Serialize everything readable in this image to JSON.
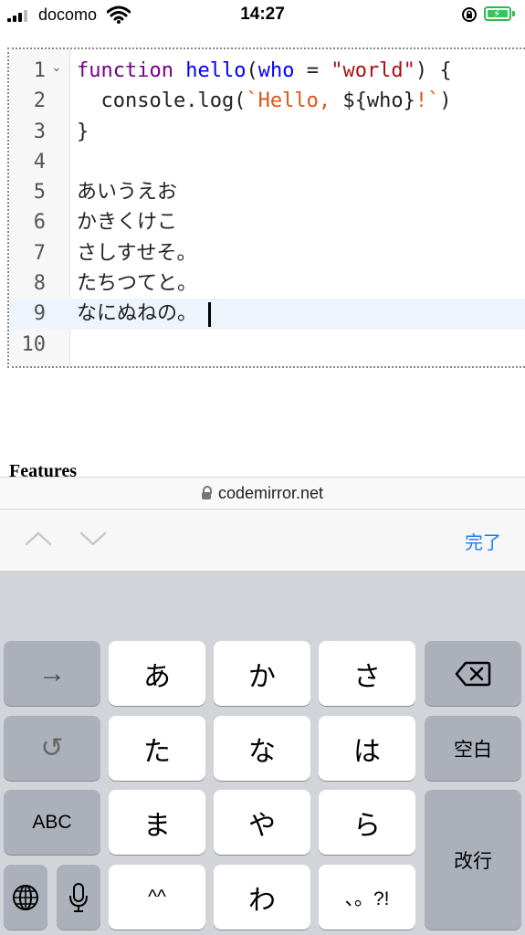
{
  "status_bar": {
    "carrier": "docomo",
    "time": "14:27"
  },
  "editor": {
    "active_line": 9,
    "fold_marker": "⌄",
    "lines": [
      {
        "number": "1",
        "text": "function hello(who = \"world\") {"
      },
      {
        "number": "2",
        "text": "  console.log(`Hello, ${who}!`)"
      },
      {
        "number": "3",
        "text": "}"
      },
      {
        "number": "4",
        "text": ""
      },
      {
        "number": "5",
        "text": "あいうえお"
      },
      {
        "number": "6",
        "text": "かきくけこ"
      },
      {
        "number": "7",
        "text": "さしすせそ。"
      },
      {
        "number": "8",
        "text": "たちつてと。"
      },
      {
        "number": "9",
        "text": "なにぬねの。"
      },
      {
        "number": "10",
        "text": ""
      }
    ]
  },
  "page": {
    "heading": "Features"
  },
  "browser": {
    "url": "codemirror.net"
  },
  "toolbar": {
    "done_label": "完了"
  },
  "keyboard": {
    "next_label": "→",
    "undo_label": "↺",
    "abc_label": "ABC",
    "row1": [
      "あ",
      "か",
      "さ"
    ],
    "row2": [
      "た",
      "な",
      "は"
    ],
    "row3": [
      "ま",
      "や",
      "ら"
    ],
    "row4": [
      "^^",
      "わ",
      "、。?!"
    ],
    "space_label": "空白",
    "return_label": "改行"
  },
  "colors": {
    "keyword": "#770088",
    "function": "#0000ff",
    "string": "#aa1111",
    "template": "#e0541a",
    "accent": "#1a7cf5"
  }
}
